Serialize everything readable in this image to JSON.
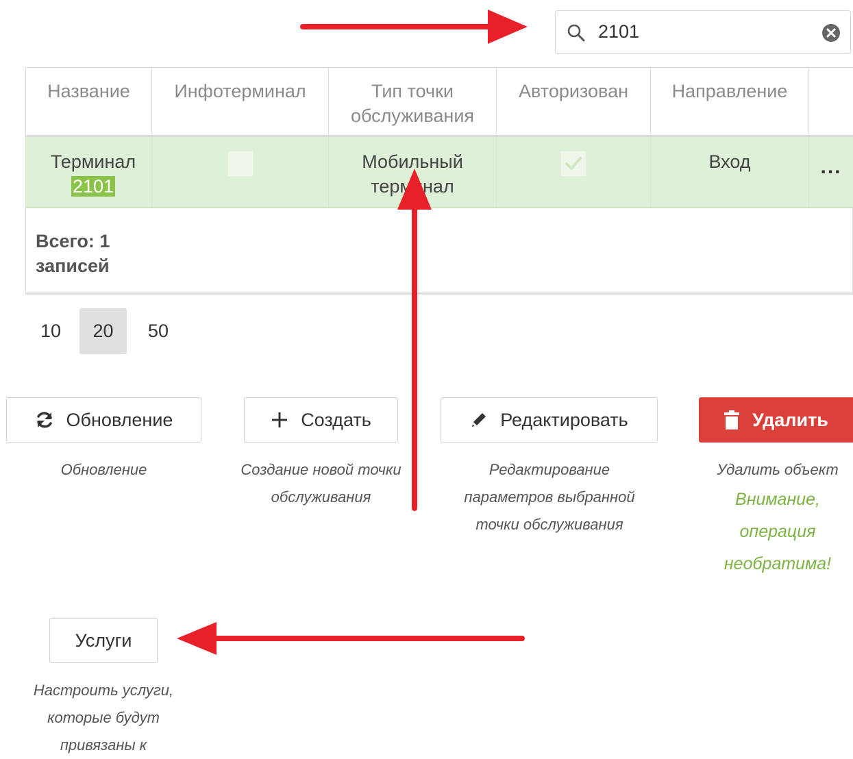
{
  "search": {
    "value": "2101"
  },
  "table": {
    "headers": [
      "Название",
      "Инфотерминал",
      "Тип точки обслуживания",
      "Авторизован",
      "Направление",
      ""
    ],
    "row": {
      "name_prefix": "Терминал",
      "name_highlight": "2101",
      "infoterminal_checked": false,
      "type": "Мобильный терминал",
      "authorized_checked": true,
      "direction": "Вход",
      "menu": "..."
    },
    "total": "Всего: 1 записей"
  },
  "pager": {
    "sizes": [
      "10",
      "20",
      "50"
    ],
    "active": "20"
  },
  "buttons": {
    "refresh": {
      "label": "Обновление",
      "caption": "Обновление"
    },
    "create": {
      "label": "Создать",
      "caption": "Создание новой точки обслуживания"
    },
    "edit": {
      "label": "Редактировать",
      "caption": "Редактирование параметров выбранной точки обслуживания"
    },
    "delete": {
      "label": "Удалить",
      "caption": "Удалить объект",
      "warning": "Внимание, операция необратима!"
    },
    "services": {
      "label": "Услуги",
      "caption": "Настроить услуги, которые будут привязаны к"
    }
  },
  "colors": {
    "row_selected": "#dff0d8",
    "highlight": "#8bc34a",
    "danger": "#d9413a",
    "warning_text": "#7cb342",
    "annotation_arrow": "#e8202a"
  }
}
